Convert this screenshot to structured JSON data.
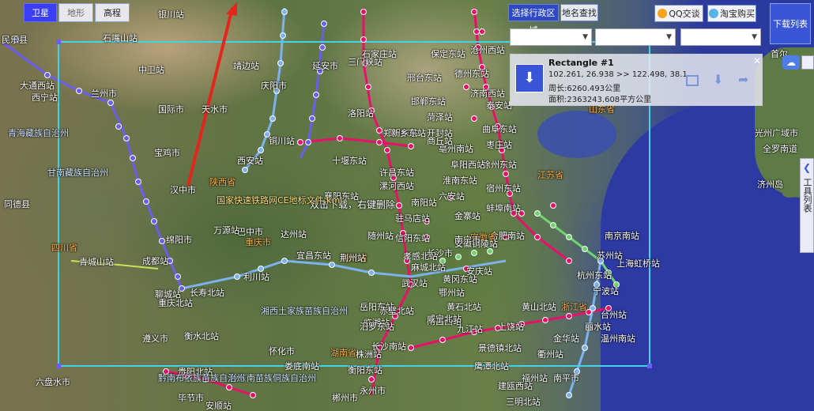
{
  "map_type_tabs": [
    "卫星",
    "地形",
    "高程"
  ],
  "active_tab": "卫星",
  "top_buttons": {
    "admin_region": "选择行政区域",
    "place_search": "地名查找",
    "qq": "QQ交谈",
    "taobao": "淘宝购买"
  },
  "download_list_button": "下载列表",
  "side_toolbox_label": "工具列表",
  "selects": [
    "",
    "",
    ""
  ],
  "rectangle": {
    "title": "Rectangle #1",
    "coords": "102.261, 26.938 >> 122.498, 38.1",
    "perimeter": "周长:6260.493公里",
    "area": "面积:2363243.608平方公里"
  },
  "hint": "双击下载，右键删除",
  "map_labels": [
    "民乐县",
    "兰州市",
    "西宁站",
    "大通西站",
    "同德县",
    "青海藏族自治州",
    "甘南藏族自治州",
    "天水市",
    "庆阳市",
    "国际市",
    "中卫站",
    "银川站",
    "石嘴山站",
    "靖边站",
    "西安站",
    "延安市",
    "铜川站",
    "宝鸡市",
    "汉中市",
    "陕西省",
    "巴中市",
    "绵阳市",
    "四川省",
    "成都站",
    "青城山站",
    "重庆北站",
    "利川站",
    "长寿北站",
    "重庆市",
    "万源站",
    "达州站",
    "湖北省",
    "宜昌东站",
    "荆州站",
    "武汉站",
    "岳阳东站",
    "长沙南站",
    "湖南省",
    "株洲站",
    "娄底南站",
    "衡阳东站",
    "永州市",
    "郴州市",
    "怀化市",
    "贵阳北站",
    "遵义市",
    "六盘水市",
    "毕节市",
    "安顺站",
    "南阳站",
    "信阳东站",
    "驻马店站",
    "许昌东站",
    "郑州东站",
    "漯河西站",
    "开封站",
    "洛阳站",
    "三门峡站",
    "新乡东站",
    "邯郸东站",
    "邢台东站",
    "石家庄站",
    "保定东站",
    "沧州西站",
    "德州东站",
    "济南西站",
    "泰安站",
    "曲阜东站",
    "枣庄站",
    "徐州东站",
    "宿州东站",
    "蚌埠南站",
    "合肥南站",
    "安庆站",
    "黄山北站",
    "南昌西站",
    "九江站",
    "上饶站",
    "景德镇北站",
    "鹰潭北站",
    "南京南站",
    "苏州站",
    "上海虹桥站",
    "杭州东站",
    "宁波站",
    "温州南站",
    "台州站",
    "丽水站",
    "金华站",
    "衢州站",
    "福州站",
    "建瓯西站",
    "南平市",
    "三明北站",
    "江苏省",
    "安徽省",
    "浙江省",
    "山东省",
    "济州岛",
    "光州广域市",
    "全罗南道",
    "首尔",
    "安徽铜陵站",
    "长沙市",
    "湘西土家族苗族自治州",
    "黔东南苗族侗族自治州",
    "黔南布依族苗族自治州",
    "国家快速铁路网CE地标文件.kml",
    "十堰东站",
    "襄阳东站",
    "随州站",
    "孝感北站",
    "麻城北站",
    "黄冈东站",
    "鄂州站",
    "黄石北站",
    "咸宁北站",
    "赤壁北站",
    "临湘站",
    "汨罗东站",
    "南宁市",
    "金寨站",
    "六安站",
    "淮南东站",
    "阜阳西站",
    "亳州南站",
    "商丘站",
    "菏泽站",
    "聊城站",
    "衡水北站"
  ],
  "colors": {
    "sea": "#2d3aa3",
    "rect_border": "#3fd4e8",
    "station_pink": "#e8106a",
    "station_blue": "#7cb2f0",
    "station_purple": "#6b5ee8",
    "station_green": "#6fd46f"
  },
  "icons": [
    "download-icon",
    "edit-icon",
    "share-icon",
    "close-icon",
    "qq-icon",
    "taobao-icon",
    "cloud-icon",
    "chevron-left-icon"
  ]
}
